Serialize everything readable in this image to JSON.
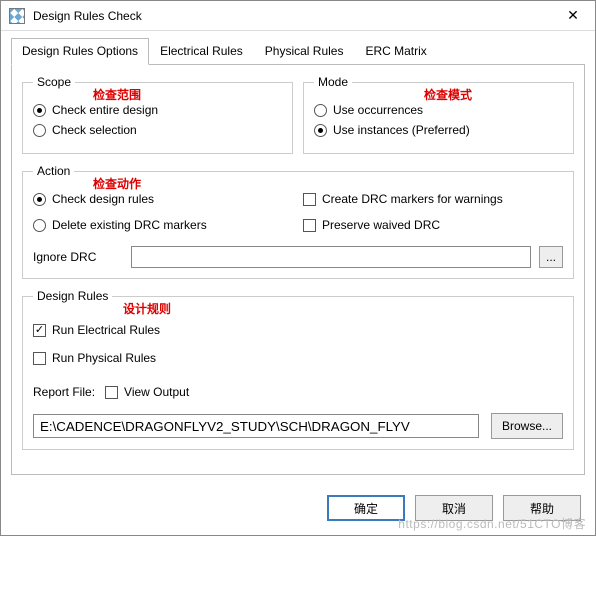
{
  "title": "Design Rules Check",
  "tabs": [
    {
      "label": "Design Rules Options",
      "active": true
    },
    {
      "label": "Electrical Rules"
    },
    {
      "label": "Physical Rules"
    },
    {
      "label": "ERC Matrix"
    }
  ],
  "scope": {
    "legend": "Scope",
    "annotation": "检查范围",
    "opt1": "Check entire design",
    "opt2": "Check selection",
    "selected": 0
  },
  "mode": {
    "legend": "Mode",
    "annotation": "检查模式",
    "opt1": "Use occurrences",
    "opt2": "Use instances (Preferred)",
    "selected": 1
  },
  "action": {
    "legend": "Action",
    "annotation": "检查动作",
    "opt1": "Check design rules",
    "opt2": "Delete existing DRC markers",
    "chk1": "Create DRC markers for warnings",
    "chk2": "Preserve waived DRC",
    "ignore_label": "Ignore DRC",
    "ignore_value": "",
    "dots": "..."
  },
  "rules": {
    "legend": "Design Rules",
    "annotation": "设计规则",
    "chk_elec": "Run Electrical Rules",
    "chk_phys": "Run Physical Rules",
    "report_label": "Report File:",
    "view_output": "View Output",
    "path": "E:\\CADENCE\\DRAGONFLYV2_STUDY\\SCH\\DRAGON_FLYV",
    "browse": "Browse..."
  },
  "footer": {
    "ok": "确定",
    "cancel": "取消",
    "help": "帮助"
  },
  "watermark": "https://blog.csdn.net/51CTO博客"
}
